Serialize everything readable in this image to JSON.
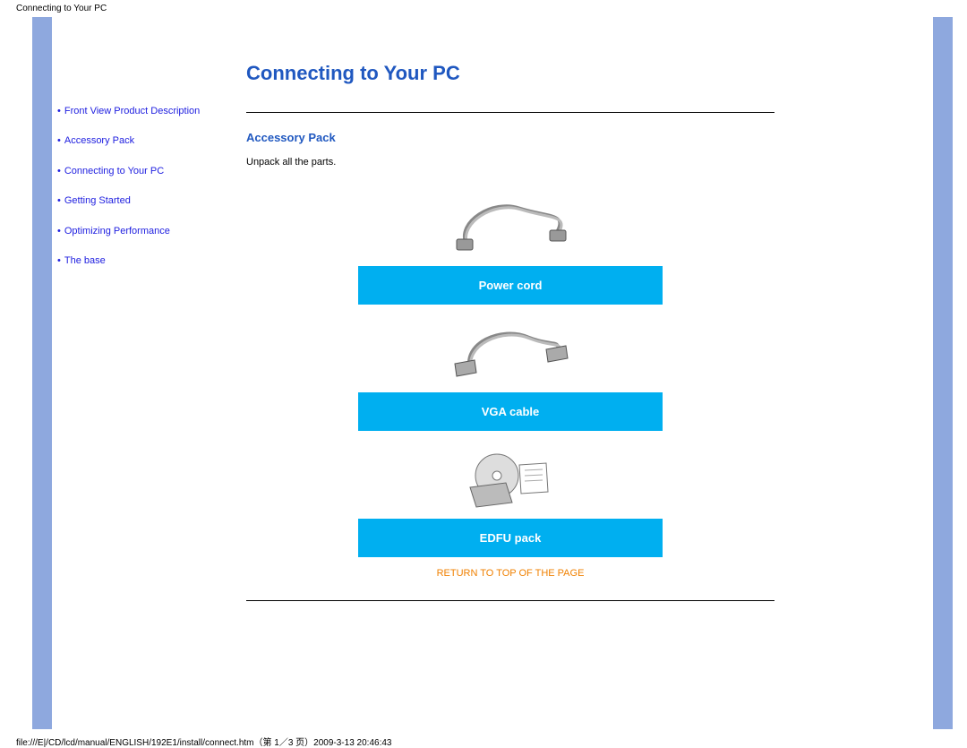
{
  "top_small_title": "Connecting to Your PC",
  "page_title": "Connecting to Your PC",
  "sidebar": {
    "items": [
      "Front View Product Description",
      "Accessory Pack",
      "Connecting to Your PC",
      "Getting Started",
      "Optimizing Performance",
      "The base"
    ]
  },
  "section": {
    "title": "Accessory Pack",
    "intro": "Unpack all the parts."
  },
  "accessories": [
    {
      "label": "Power cord"
    },
    {
      "label": "VGA cable"
    },
    {
      "label": "EDFU pack"
    }
  ],
  "return_top": "RETURN TO TOP OF THE PAGE",
  "footer": "file:///E|/CD/lcd/manual/ENGLISH/192E1/install/connect.htm（第 1／3 页）2009-3-13 20:46:43",
  "colors": {
    "vbar": "#8ea8de",
    "heading": "#2058c0",
    "link": "#2020e0",
    "accent": "#00aff0",
    "return": "#f08000"
  }
}
